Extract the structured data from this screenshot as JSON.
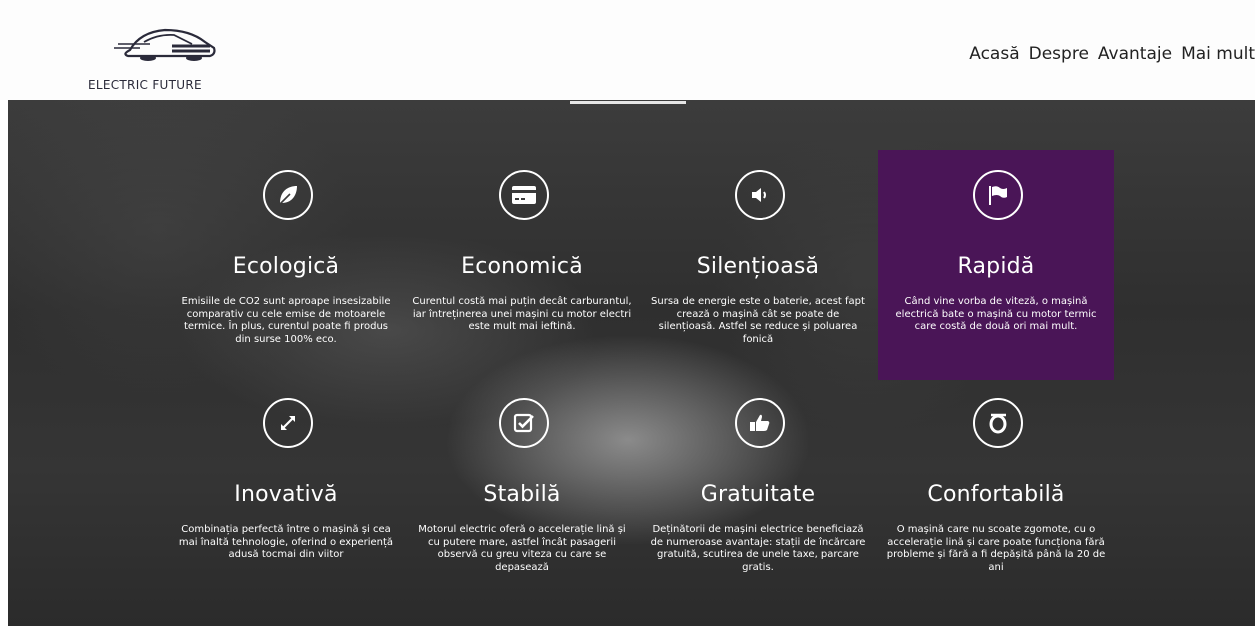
{
  "header": {
    "logo_text": "ELECTRIC FUTURE",
    "nav": [
      "Acasă",
      "Despre",
      "Avantaje",
      "Mai mult"
    ]
  },
  "colors": {
    "highlight": "#4a1557",
    "hero_bg": "#333333",
    "text_light": "#ffffff"
  },
  "features": [
    {
      "icon": "leaf-icon",
      "title": "Ecologică",
      "text": "Emisiile de CO2 sunt aproape insesizabile comparativ cu cele emise de motoarele termice. În plus, curentul poate fi produs din surse 100% eco."
    },
    {
      "icon": "credit-card-icon",
      "title": "Economică",
      "text": "Curentul costă mai puțin decât carburantul, iar întreținerea unei mașini cu motor electri este mult mai ieftină."
    },
    {
      "icon": "volume-icon",
      "title": "Silențioasă",
      "text": "Sursa de energie este o baterie, acest fapt crează o mașină cât se poate de silențioasă. Astfel se reduce și poluarea fonică"
    },
    {
      "icon": "flag-icon",
      "title": "Rapidă",
      "text": "Când vine vorba de viteză, o mașină electrică bate o mașină cu motor termic care costă de două ori mai mult.",
      "highlighted": true
    },
    {
      "icon": "expand-arrows-icon",
      "title": "Inovativă",
      "text": "Combinația perfectă între o mașină și cea mai înaltă tehnologie, oferind o experiență adusă tocmai din viitor"
    },
    {
      "icon": "checkbox-icon",
      "title": "Stabilă",
      "text": "Motorul electric oferă o accelerație lină și cu putere mare, astfel încât pasagerii observă cu greu viteza cu care se depasează"
    },
    {
      "icon": "thumbs-up-icon",
      "title": "Gratuitate",
      "text": "Deținătorii de mașini electrice beneficiază de numeroase avantaje: stații de încărcare gratuită, scutirea de unele taxe, parcare gratis."
    },
    {
      "icon": "ring-icon",
      "title": "Confortabilă",
      "text": "O mașină care nu scoate zgomote, cu o accelerație lină și care poate funcționa fără probleme și fără a fi depășită până la 20 de ani"
    }
  ]
}
